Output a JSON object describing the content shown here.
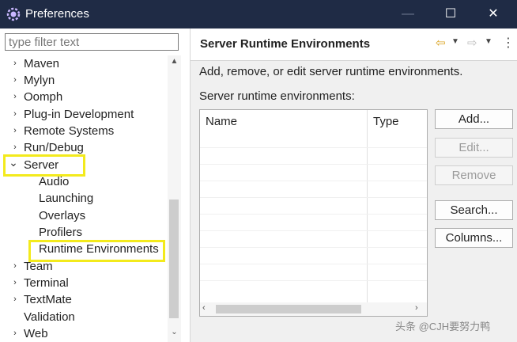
{
  "window": {
    "title": "Preferences",
    "icon": "eclipse-preferences-icon",
    "minimize_glyph": "—",
    "maximize_glyph": "☐",
    "close_glyph": "✕"
  },
  "sidebar": {
    "filter_placeholder": "type filter text",
    "items": [
      {
        "label": "Maven",
        "chevron": "›"
      },
      {
        "label": "Mylyn",
        "chevron": "›"
      },
      {
        "label": "Oomph",
        "chevron": "›"
      },
      {
        "label": "Plug-in Development",
        "chevron": "›"
      },
      {
        "label": "Remote Systems",
        "chevron": "›"
      },
      {
        "label": "Run/Debug",
        "chevron": "›"
      },
      {
        "label": "Server",
        "chevron": "⌄"
      },
      {
        "label": "Audio"
      },
      {
        "label": "Launching"
      },
      {
        "label": "Overlays"
      },
      {
        "label": "Profilers"
      },
      {
        "label": "Runtime Environments"
      },
      {
        "label": "Team",
        "chevron": "›"
      },
      {
        "label": "Terminal",
        "chevron": "›"
      },
      {
        "label": "TextMate",
        "chevron": "›"
      },
      {
        "label": "Validation"
      },
      {
        "label": "Web",
        "chevron": "›"
      }
    ],
    "scroll_up_glyph": "▲",
    "scroll_down_glyph": "⌄"
  },
  "main": {
    "title": "Server Runtime Environments",
    "nav": {
      "back_glyph": "⇦",
      "forward_glyph": "⇨",
      "dropdown_glyph": "▼",
      "more_glyph": "⋮"
    },
    "description": "Add, remove, or edit server runtime environments.",
    "list_label": "Server runtime environments:",
    "table": {
      "columns": [
        "Name",
        "Type"
      ],
      "rows": [],
      "scroll_left_glyph": "‹",
      "scroll_right_glyph": "›"
    },
    "buttons": {
      "add": "Add...",
      "edit": "Edit...",
      "remove": "Remove",
      "search": "Search...",
      "columns": "Columns..."
    }
  },
  "highlight_color": "#f3ea1c",
  "watermark": "头条 @CJH要努力鸭"
}
